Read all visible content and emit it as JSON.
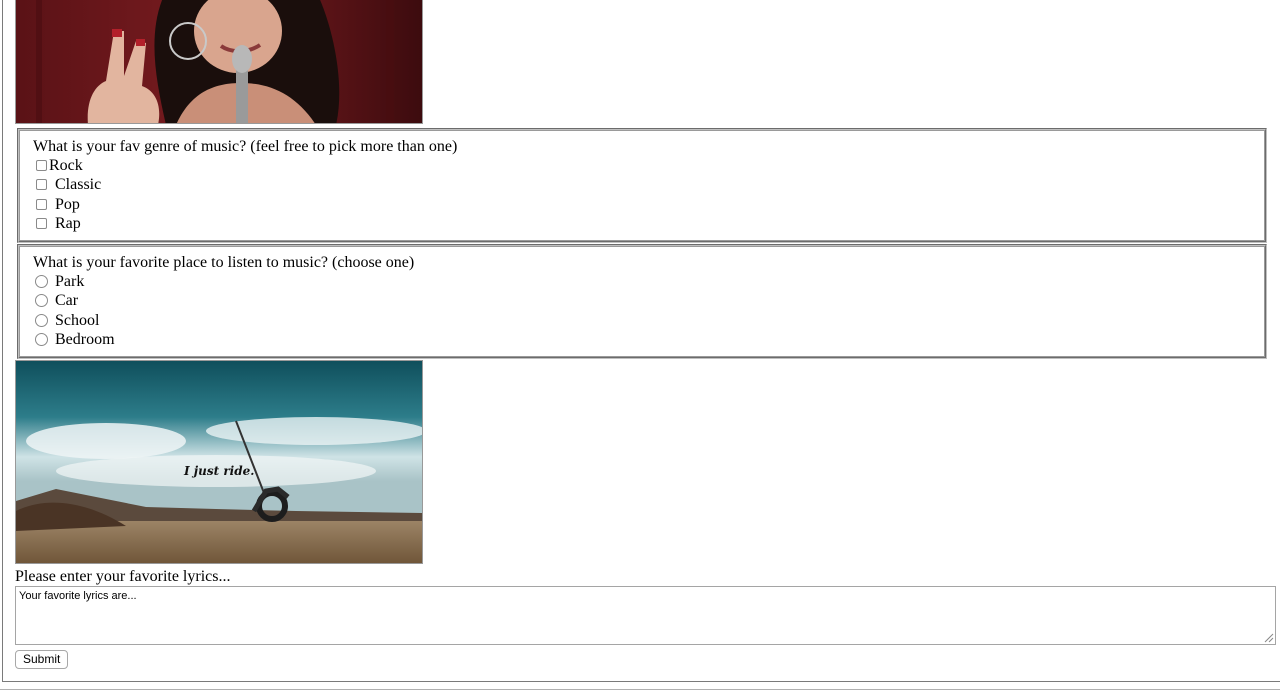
{
  "images": {
    "top_photo_icon": "singer-photo-icon",
    "bottom_photo_icon": "desert-swing-photo-icon",
    "bottom_photo_caption": "I just ride."
  },
  "genre": {
    "question": "What is your fav genre of music? (feel free to pick more than one)",
    "options": [
      {
        "label": "Rock",
        "checked": false
      },
      {
        "label": "Classic",
        "checked": false
      },
      {
        "label": "Pop",
        "checked": false
      },
      {
        "label": "Rap",
        "checked": false
      }
    ]
  },
  "place": {
    "question": "What is your favorite place to listen to music? (choose one)",
    "options": [
      {
        "label": "Park",
        "selected": false
      },
      {
        "label": "Car",
        "selected": false
      },
      {
        "label": "School",
        "selected": false
      },
      {
        "label": "Bedroom",
        "selected": false
      }
    ]
  },
  "lyrics": {
    "label": "Please enter your favorite lyrics...",
    "value": "Your favorite lyrics are..."
  },
  "submit": {
    "label": "Submit"
  }
}
